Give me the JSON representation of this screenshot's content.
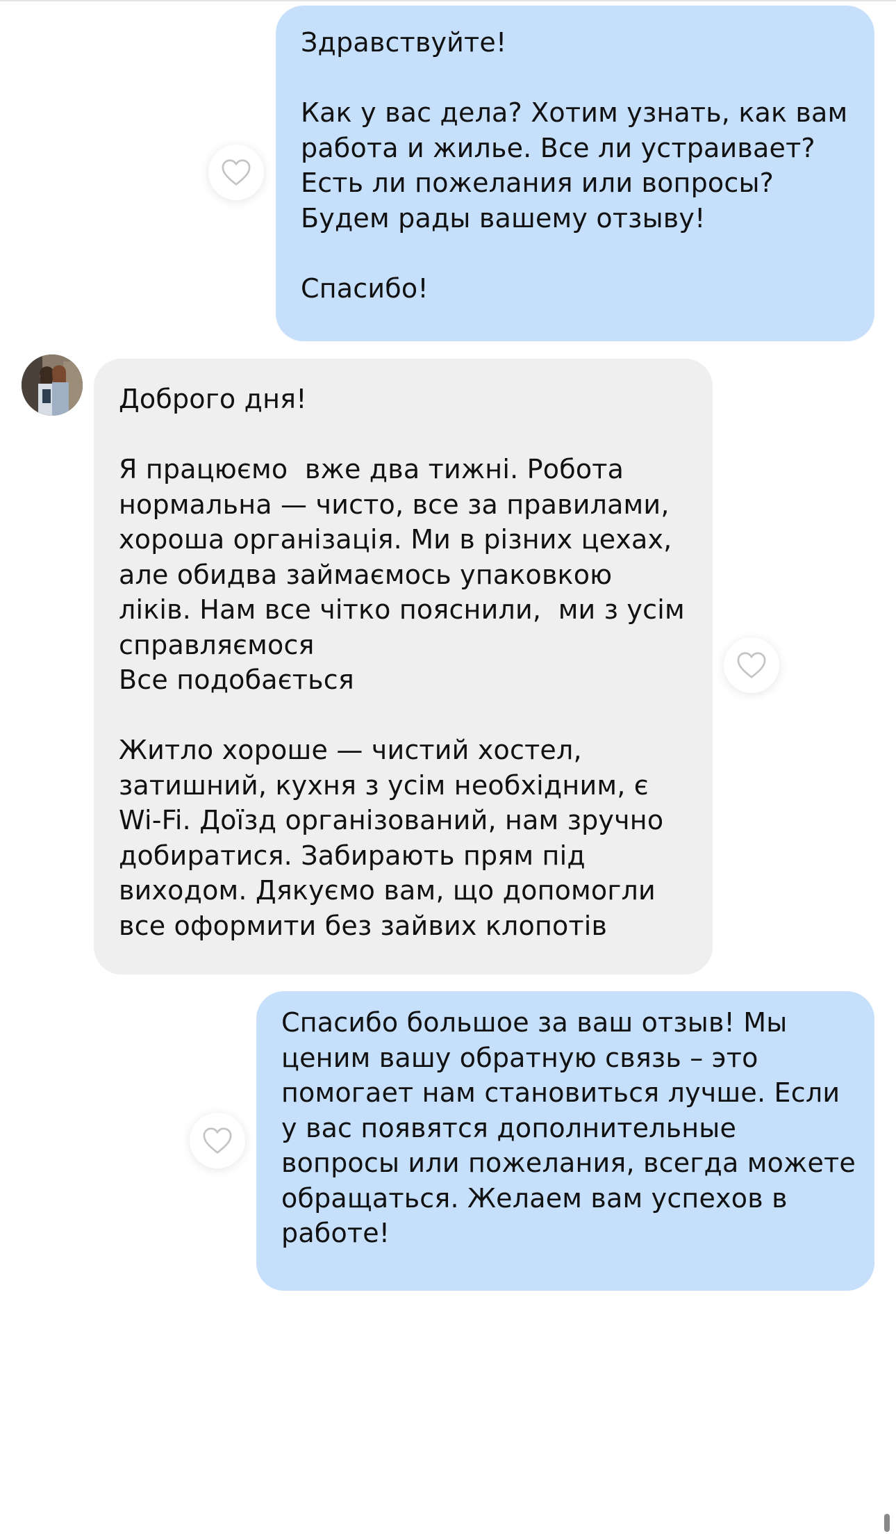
{
  "conversation": {
    "messages": [
      {
        "direction": "outgoing",
        "text": "Здравствуйте!\n\nКак у вас дела? Хотим узнать, как вам\nработа и жилье. Все ли устраивает?\nЕсть ли пожелания или вопросы?\nБудем рады вашему отзыву!\n\nСпасибо!"
      },
      {
        "direction": "incoming",
        "text": "Доброго дня!\n\nЯ працюємо  вже два тижні. Робота\nнормальна — чисто, все за правилами,\nхороша організація. Ми в різних цехах,\nале обидва займаємось упаковкою\nліків. Нам все чітко пояснили,  ми з усім\nсправляємося\nВсе подобається\n\nЖитло хороше — чистий хостел,\nзатишний, кухня з усім необхідним, є\nWi-Fi. Доїзд організований, нам зручно\nдобиратися. Забирають прям під\nвиходом. Дякуємо вам, що допомогли\nвсе оформити без зайвих клопотів"
      },
      {
        "direction": "outgoing",
        "text": "Спасибо большое за ваш отзыв! Мы\nценим вашу обратную связь – это\nпомогает нам становиться лучше. Если\nу вас появятся дополнительные\nвопросы или пожелания, всегда можете\nобращаться. Желаем вам успехов в\nработе!"
      }
    ]
  },
  "icons": {
    "like": "heart-outline-icon",
    "avatar": "user-avatar-photo"
  },
  "colors": {
    "outgoing_bubble": "#c6dffb",
    "incoming_bubble": "#efefef",
    "text": "#111111",
    "heart_stroke": "#c4c4c4"
  }
}
